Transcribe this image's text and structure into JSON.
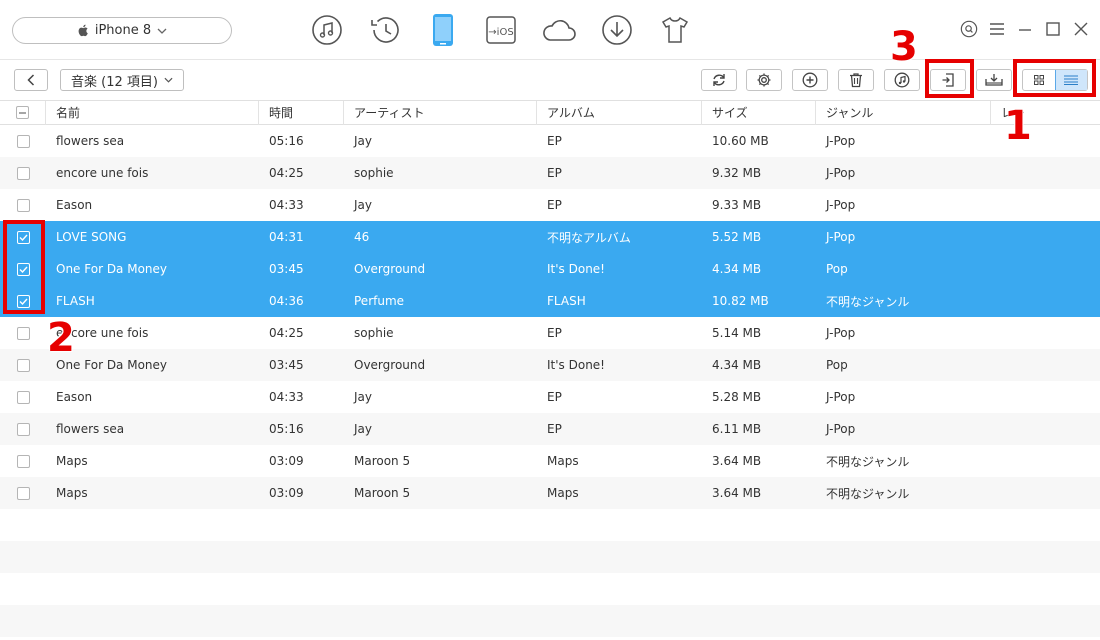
{
  "header": {
    "device_name": "iPhone 8",
    "nav_icons": [
      "music-icon",
      "history-icon",
      "device-icon",
      "ios-transfer-icon",
      "cloud-icon",
      "download-icon",
      "tshirt-icon"
    ],
    "ios_label": "→iOS"
  },
  "toolbar": {
    "category_label": "音楽 (12 項目)"
  },
  "annotations": {
    "n1": "1",
    "n2": "2",
    "n3": "3"
  },
  "table": {
    "headers": [
      "名前",
      "時間",
      "アーティスト",
      "アルバム",
      "サイズ",
      "ジャンル",
      "レー"
    ],
    "rows": [
      {
        "name": "flowers sea",
        "time": "05:16",
        "artist": "Jay",
        "album": "EP",
        "size": "10.60 MB",
        "genre": "J-Pop",
        "selected": false
      },
      {
        "name": "encore une fois",
        "time": "04:25",
        "artist": "sophie",
        "album": "EP",
        "size": "9.32 MB",
        "genre": "J-Pop",
        "selected": false
      },
      {
        "name": "Eason",
        "time": "04:33",
        "artist": "Jay",
        "album": " EP",
        "size": "9.33 MB",
        "genre": "J-Pop",
        "selected": false
      },
      {
        "name": "LOVE SONG",
        "time": "04:31",
        "artist": "46",
        "album": "不明なアルバム",
        "size": "5.52 MB",
        "genre": "J-Pop",
        "selected": true
      },
      {
        "name": "One For Da Money",
        "time": "03:45",
        "artist": "Overground",
        "album": "It's Done!",
        "size": "4.34 MB",
        "genre": "Pop",
        "selected": true
      },
      {
        "name": "FLASH",
        "time": "04:36",
        "artist": "Perfume",
        "album": "FLASH",
        "size": "10.82 MB",
        "genre": "不明なジャンル",
        "selected": true
      },
      {
        "name": "encore une fois",
        "time": "04:25",
        "artist": "sophie",
        "album": "EP",
        "size": "5.14 MB",
        "genre": "J-Pop",
        "selected": false
      },
      {
        "name": "One For Da Money",
        "time": "03:45",
        "artist": "Overground",
        "album": "It's Done!",
        "size": "4.34 MB",
        "genre": "Pop",
        "selected": false
      },
      {
        "name": "Eason",
        "time": "04:33",
        "artist": "Jay",
        "album": " EP",
        "size": "5.28 MB",
        "genre": "J-Pop",
        "selected": false
      },
      {
        "name": "flowers sea",
        "time": "05:16",
        "artist": "Jay",
        "album": "EP",
        "size": "6.11 MB",
        "genre": "J-Pop",
        "selected": false
      },
      {
        "name": "Maps",
        "time": "03:09",
        "artist": "Maroon 5",
        "album": "Maps",
        "size": "3.64 MB",
        "genre": "不明なジャンル",
        "selected": false
      },
      {
        "name": "Maps",
        "time": "03:09",
        "artist": "Maroon 5",
        "album": "Maps",
        "size": "3.64 MB",
        "genre": "不明なジャンル",
        "selected": false
      }
    ]
  },
  "colors": {
    "selected_row": "#3aa9f0",
    "annotation_red": "#e60000"
  }
}
